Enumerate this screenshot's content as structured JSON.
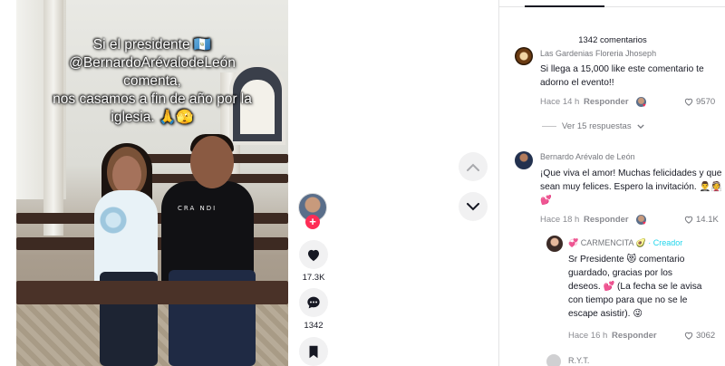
{
  "video": {
    "caption_lines": [
      "Si el presidente 🇬🇹",
      "@BernardoArévalodeLeón",
      "comenta,",
      "nos casamos a fin de año por la",
      "iglesia. 🙏🫣"
    ],
    "shirt_text": "CRA NDI"
  },
  "actions": {
    "likes": "17.3K",
    "comments": "1342",
    "follow_symbol": "+"
  },
  "comments_panel": {
    "count_label": "1342 comentarios",
    "comments": [
      {
        "author": "Las Gardenias Floreria Jhoseph",
        "text": "Si llega a 15,000 like este comentario te adorno el evento!!",
        "time": "Hace 14 h",
        "reply_label": "Responder",
        "likes": "9570",
        "view_replies": "Ver 15 respuestas"
      },
      {
        "author": "Bernardo Arévalo de León",
        "text": "¡Que viva el amor! Muchas felicidades y que sean muy felices. Espero la invitación. 🤵‍♂️👰 💕",
        "time": "Hace 18 h",
        "reply_label": "Responder",
        "likes": "14.1K"
      }
    ],
    "reply": {
      "author": "💞 CARMENCITA 🥑",
      "creator_tag": "· Creador",
      "text_lines": [
        "Sr Presidente 😻 comentario",
        "guardado, gracias por los",
        "deseos. 💕 (La fecha se le avisa",
        "con tiempo para que no se le",
        "escape asistir). 😜"
      ],
      "time": "Hace 16 h",
      "reply_label": "Responder",
      "likes": "3062"
    },
    "next_author": "R.Y.T."
  },
  "icons": {
    "like": "heart-icon",
    "comment": "comment-icon",
    "save": "bookmark-icon",
    "up": "chevron-up-icon",
    "down": "chevron-down-icon"
  },
  "colors": {
    "accent": "#fe2c55",
    "creator": "#20d5ec"
  }
}
